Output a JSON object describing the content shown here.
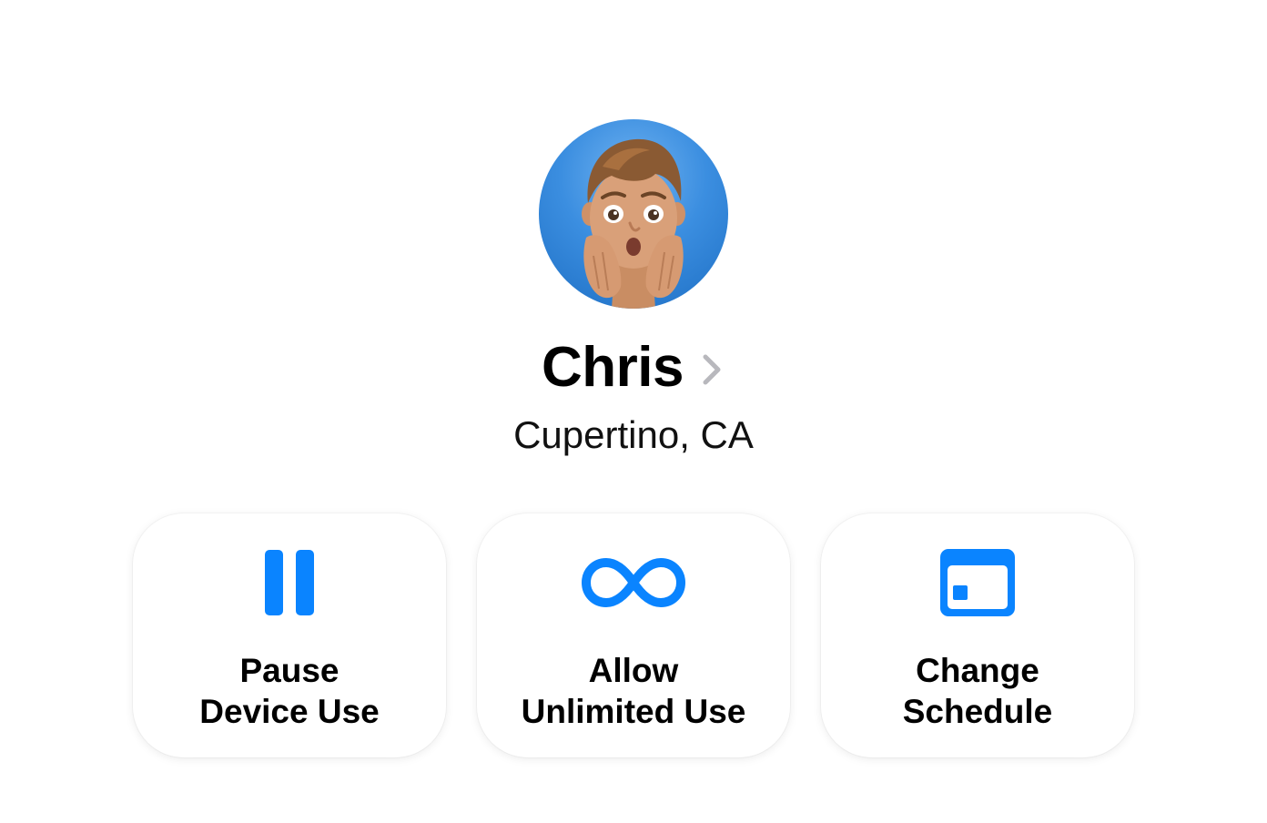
{
  "colors": {
    "accent": "#0A84FF",
    "chevron": "#B8B8BD",
    "avatar_background": "#3B8EE0"
  },
  "profile": {
    "avatar_icon": "memoji-avatar",
    "name": "Chris",
    "location": "Cupertino, CA",
    "chevron_icon": "chevron-right-icon"
  },
  "actions": [
    {
      "icon": "pause-icon",
      "line1": "Pause",
      "line2": "Device Use"
    },
    {
      "icon": "infinity-icon",
      "line1": "Allow",
      "line2": "Unlimited Use"
    },
    {
      "icon": "calendar-icon",
      "line1": "Change",
      "line2": "Schedule"
    }
  ]
}
